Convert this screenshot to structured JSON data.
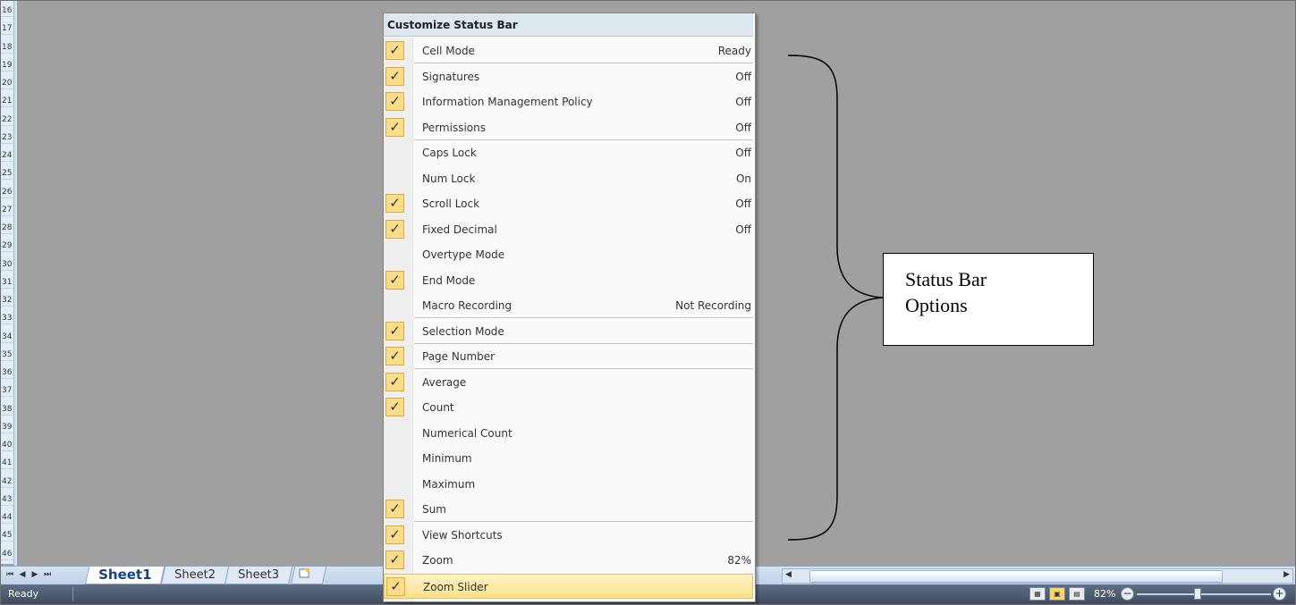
{
  "row_headers": [
    "16",
    "17",
    "18",
    "19",
    "20",
    "21",
    "22",
    "23",
    "24",
    "25",
    "26",
    "27",
    "28",
    "29",
    "30",
    "31",
    "32",
    "33",
    "34",
    "35",
    "36",
    "37",
    "38",
    "39",
    "40",
    "41",
    "42",
    "43",
    "44",
    "45",
    "46"
  ],
  "sheet_tabs": {
    "nav": [
      "⏮",
      "◀",
      "▶",
      "⏭"
    ],
    "tabs": [
      "Sheet1",
      "Sheet2",
      "Sheet3"
    ],
    "active": "Sheet1",
    "insert_icon": "insert-sheet-icon"
  },
  "status_bar": {
    "mode": "Ready",
    "zoom_percent": "82%",
    "zoom_level": 0.82,
    "view_buttons": [
      "normal-view-icon",
      "page-layout-view-icon",
      "page-break-preview-icon"
    ]
  },
  "menu": {
    "title": "Customize Status Bar",
    "items": [
      {
        "label": "Cell Mode",
        "value": "Ready",
        "checked": true
      },
      {
        "label": "Signatures",
        "value": "Off",
        "checked": true
      },
      {
        "label": "Information Management Policy",
        "value": "Off",
        "checked": true
      },
      {
        "label": "Permissions",
        "value": "Off",
        "checked": true
      },
      {
        "label": "Caps Lock",
        "value": "Off",
        "checked": false
      },
      {
        "label": "Num Lock",
        "value": "On",
        "checked": false
      },
      {
        "label": "Scroll Lock",
        "value": "Off",
        "checked": true
      },
      {
        "label": "Fixed Decimal",
        "value": "Off",
        "checked": true
      },
      {
        "label": "Overtype Mode",
        "value": "",
        "checked": false
      },
      {
        "label": "End Mode",
        "value": "",
        "checked": true
      },
      {
        "label": "Macro Recording",
        "value": "Not Recording",
        "checked": false
      },
      {
        "label": "Selection Mode",
        "value": "",
        "checked": true
      },
      {
        "label": "Page Number",
        "value": "",
        "checked": true
      },
      {
        "label": "Average",
        "value": "",
        "checked": true
      },
      {
        "label": "Count",
        "value": "",
        "checked": true
      },
      {
        "label": "Numerical Count",
        "value": "",
        "checked": false
      },
      {
        "label": "Minimum",
        "value": "",
        "checked": false
      },
      {
        "label": "Maximum",
        "value": "",
        "checked": false
      },
      {
        "label": "Sum",
        "value": "",
        "checked": true
      },
      {
        "label": "View Shortcuts",
        "value": "",
        "checked": true
      },
      {
        "label": "Zoom",
        "value": "82%",
        "checked": true
      },
      {
        "label": "Zoom Slider",
        "value": "",
        "checked": true
      }
    ],
    "check_glyph": "✓"
  },
  "annotation": {
    "line1": "Status Bar",
    "line2": "Options"
  },
  "colors": {
    "check_bg": "#fbdc88",
    "hover_bg": "#fbe08a",
    "status_bar_bg": "#4b586a",
    "grid_bg": "#a0a0a0"
  }
}
